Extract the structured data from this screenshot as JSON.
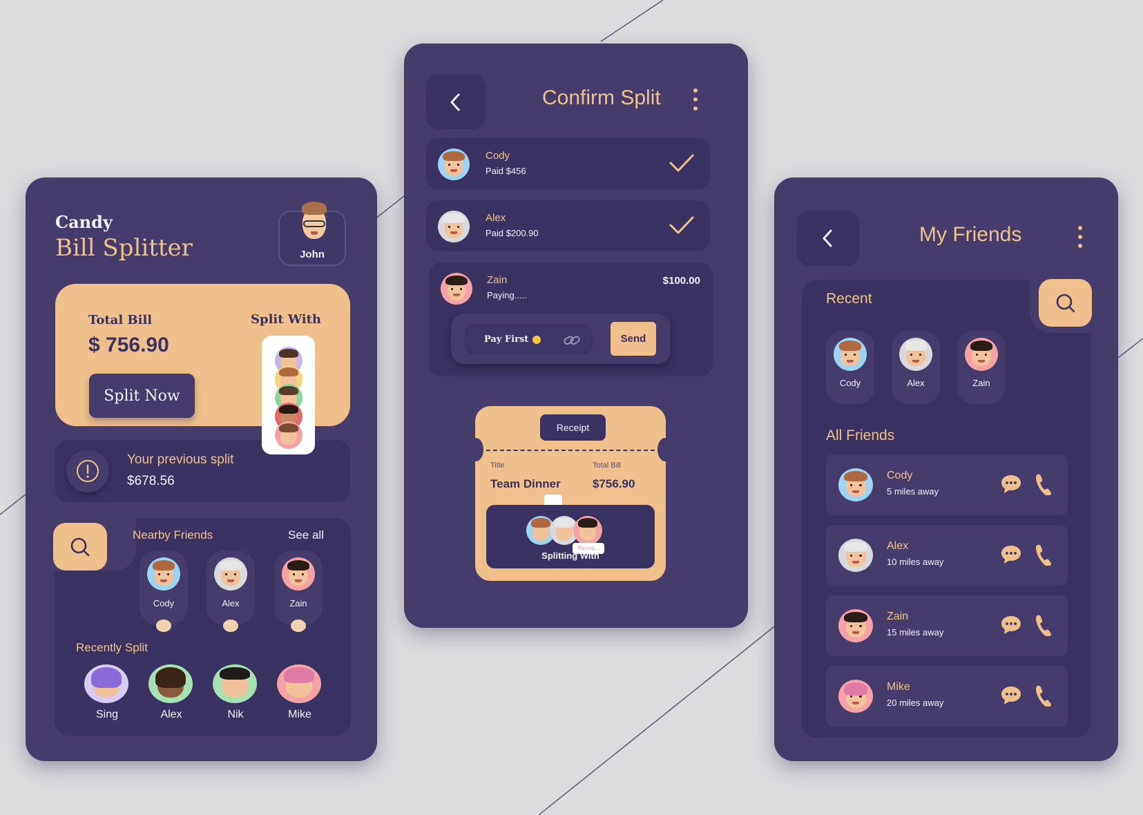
{
  "colors": {
    "page_bg": "#dcdcdf",
    "panel": "#453c6b",
    "panel_dark": "#3a3260",
    "accent": "#f0c38b",
    "text": "#f2f0f7"
  },
  "left": {
    "brand": "Candy",
    "app_title": "Bill Splitter",
    "user": {
      "name": "John",
      "avatar_icon": "memoji-glasses-icon"
    },
    "card": {
      "total_label": "Total Bill",
      "total_value": "$ 756.90",
      "split_with_label": "Split With",
      "split_button": "Split Now"
    },
    "previous": {
      "label": "Your previous split",
      "value": "$678.56",
      "icon": "info-icon"
    },
    "nearby": {
      "title": "Nearby Friends",
      "see_all": "See all",
      "friends": [
        {
          "name": "Cody"
        },
        {
          "name": "Alex"
        },
        {
          "name": "Zain"
        }
      ]
    },
    "recent": {
      "title": "Recently Split",
      "friends": [
        {
          "name": "Sing"
        },
        {
          "name": "Alex"
        },
        {
          "name": "Nik"
        },
        {
          "name": "Mike"
        }
      ]
    }
  },
  "middle": {
    "title": "Confirm Split",
    "payments": [
      {
        "name": "Cody",
        "status": "Paid $456"
      },
      {
        "name": "Alex",
        "status": "Paid $200.90"
      }
    ],
    "pending": {
      "name": "Zain",
      "status": "Paying.....",
      "amount": "$100.00",
      "pay_first_label": "Pay First",
      "send_label": "Send"
    },
    "receipt": {
      "tag": "Receipt",
      "title_label": "Title",
      "title_value": "Team Dinner",
      "total_label": "Total Bill",
      "total_value": "$756.90",
      "splitting_label": "Splitting With",
      "paying_badge": "Paying..."
    }
  },
  "right": {
    "title": "My Friends",
    "recent_label": "Recent",
    "recent": [
      {
        "name": "Cody"
      },
      {
        "name": "Alex"
      },
      {
        "name": "Zain"
      }
    ],
    "all_label": "All Friends",
    "friends": [
      {
        "name": "Cody",
        "distance": "5 miles away"
      },
      {
        "name": "Alex",
        "distance": "10 miles away"
      },
      {
        "name": "Zain",
        "distance": "15 miles away"
      },
      {
        "name": "Mike",
        "distance": "20 miles away"
      }
    ]
  }
}
